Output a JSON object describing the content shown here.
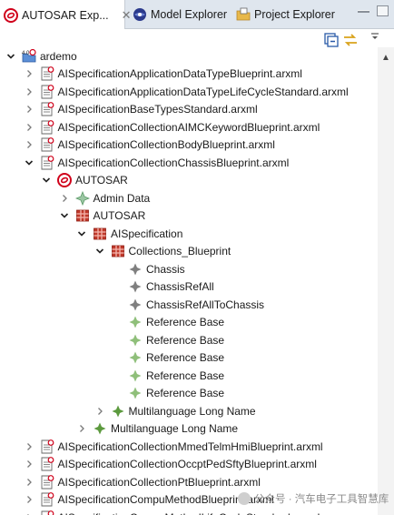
{
  "tabs": [
    {
      "label": "AUTOSAR Exp...",
      "close": "✕",
      "icon": "autosar-icon"
    },
    {
      "label": "Model Explorer",
      "icon": "model-explorer-icon"
    },
    {
      "label": "Project Explorer",
      "icon": "project-explorer-icon"
    }
  ],
  "tree": [
    {
      "label": "ardemo",
      "icon": "project",
      "expander": "open",
      "level": 0
    },
    {
      "label": "AISpecificationApplicationDataTypeBlueprint.arxml",
      "icon": "file",
      "expander": "closed",
      "level": 1
    },
    {
      "label": "AISpecificationApplicationDataTypeLifeCycleStandard.arxml",
      "icon": "file",
      "expander": "closed",
      "level": 1
    },
    {
      "label": "AISpecificationBaseTypesStandard.arxml",
      "icon": "file",
      "expander": "closed",
      "level": 1
    },
    {
      "label": "AISpecificationCollectionAIMCKeywordBlueprint.arxml",
      "icon": "file",
      "expander": "closed",
      "level": 1
    },
    {
      "label": "AISpecificationCollectionBodyBlueprint.arxml",
      "icon": "file",
      "expander": "closed",
      "level": 1
    },
    {
      "label": "AISpecificationCollectionChassisBlueprint.arxml",
      "icon": "file",
      "expander": "open",
      "level": 1
    },
    {
      "label": "AUTOSAR",
      "icon": "autosar",
      "expander": "open",
      "level": 2
    },
    {
      "label": "Admin Data",
      "icon": "admin",
      "expander": "closed",
      "level": 3
    },
    {
      "label": "AUTOSAR",
      "icon": "package",
      "expander": "open",
      "level": 3
    },
    {
      "label": "AISpecification",
      "icon": "package",
      "expander": "open",
      "level": 4
    },
    {
      "label": "Collections_Blueprint",
      "icon": "package",
      "expander": "open",
      "level": 5
    },
    {
      "label": "Chassis",
      "icon": "element-gray",
      "expander": "none",
      "level": 6
    },
    {
      "label": "ChassisRefAll",
      "icon": "element-gray",
      "expander": "none",
      "level": 6
    },
    {
      "label": "ChassisRefAllToChassis",
      "icon": "element-gray",
      "expander": "none",
      "level": 6
    },
    {
      "label": "Reference Base",
      "icon": "element-green",
      "expander": "none",
      "level": 6
    },
    {
      "label": "Reference Base",
      "icon": "element-green",
      "expander": "none",
      "level": 6
    },
    {
      "label": "Reference Base",
      "icon": "element-green",
      "expander": "none",
      "level": 6
    },
    {
      "label": "Reference Base",
      "icon": "element-green",
      "expander": "none",
      "level": 6
    },
    {
      "label": "Reference Base",
      "icon": "element-green",
      "expander": "none",
      "level": 6
    },
    {
      "label": "Multilanguage Long Name",
      "icon": "element-green-dark",
      "expander": "closed",
      "level": 5
    },
    {
      "label": "Multilanguage Long Name",
      "icon": "element-green-dark",
      "expander": "closed",
      "level": 4
    },
    {
      "label": "AISpecificationCollectionMmedTelmHmiBlueprint.arxml",
      "icon": "file",
      "expander": "closed",
      "level": 1
    },
    {
      "label": "AISpecificationCollectionOccptPedSftyBlueprint.arxml",
      "icon": "file",
      "expander": "closed",
      "level": 1
    },
    {
      "label": "AISpecificationCollectionPtBlueprint.arxml",
      "icon": "file",
      "expander": "closed",
      "level": 1
    },
    {
      "label": "AISpecificationCompuMethodBlueprint.arxml",
      "icon": "file",
      "expander": "closed",
      "level": 1
    },
    {
      "label": "AISpecificationCompuMethodLifeCycleStandard.arxml",
      "icon": "file",
      "expander": "closed",
      "level": 1
    }
  ],
  "watermark": {
    "text": "公众号 · 汽车电子工具智慧库"
  },
  "colors": {
    "tabbar": "#dfe6ee",
    "autosar_red": "#d0021b",
    "package_red": "#c0392b",
    "element_green": "#6aa84f",
    "element_gray": "#7f7f7f"
  }
}
